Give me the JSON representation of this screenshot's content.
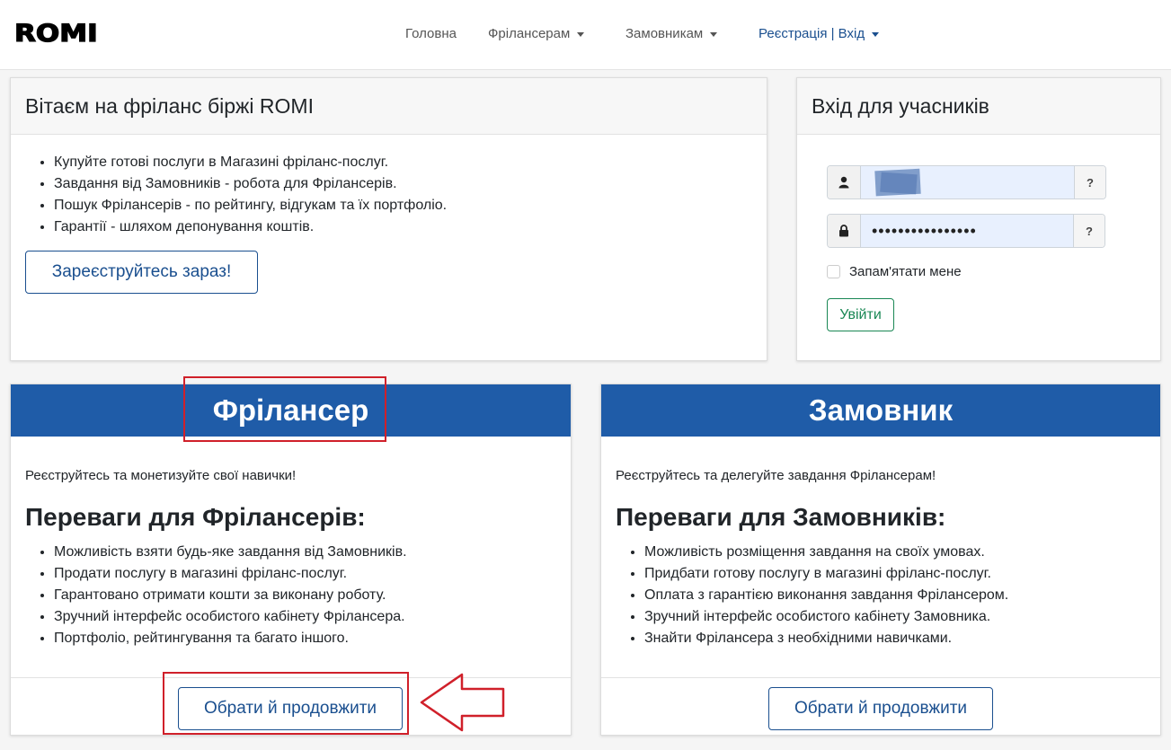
{
  "brand": {
    "logo_text": "ROMI"
  },
  "nav": {
    "home": "Головна",
    "freelancers": "Фрілансерам",
    "customers": "Замовникам",
    "register_login": "Реєстрація | Вхід"
  },
  "welcome": {
    "title": "Вітаєм на фріланс біржі ROMI",
    "items": [
      "Купуйте готові послуги в Магазині фріланс-послуг.",
      "Завдання від Замовників - робота для Фрілансерів.",
      "Пошук Фрілансерів - по рейтингу, відгукам та їх портфоліо.",
      "Гарантії - шляхом депонування коштів."
    ],
    "register_button": "Зареєструйтесь зараз!"
  },
  "login": {
    "title": "Вхід для учасників",
    "username_value": "",
    "password_value": "••••••••••••••••",
    "help_mark": "?",
    "remember_label": "Запам'ятати мене",
    "submit_label": "Увійти"
  },
  "freelancer": {
    "title": "Фрілансер",
    "intro": "Реєструйтесь та монетизуйте свої навички!",
    "benefits_title": "Переваги для Фрілансерів:",
    "benefits": [
      "Можливість взяти будь-яке завдання від Замовників.",
      "Продати послугу в магазині фріланс-послуг.",
      "Гарантовано отримати кошти за виконану роботу.",
      "Зручний інтерфейс особистого кабінету Фрілансера.",
      "Портфоліо, рейтингування та багато іншого."
    ],
    "continue_button": "Обрати й продовжити"
  },
  "customer": {
    "title": "Замовник",
    "intro": "Реєструйтесь та делегуйте завдання Фрілансерам!",
    "benefits_title": "Переваги для Замовників:",
    "benefits": [
      "Можливість розміщення завдання на своїх умовах.",
      "Придбати готову послугу в магазині фріланс-послуг.",
      "Оплата з гарантією виконання завдання Фрілансером.",
      "Зручний інтерфейс особистого кабінету Замовника.",
      "Знайти Фрілансера з необхідними навичками."
    ],
    "continue_button": "Обрати й продовжити"
  },
  "icons": {
    "user": "user-icon",
    "lock": "lock-icon",
    "caret": "caret-down-icon",
    "arrow": "left-arrow-annotation"
  },
  "colors": {
    "primary": "#1f5ca8",
    "link": "#1a4f8f",
    "success": "#198754",
    "annotation": "#d0202a",
    "autofill": "#e8f0fe"
  }
}
